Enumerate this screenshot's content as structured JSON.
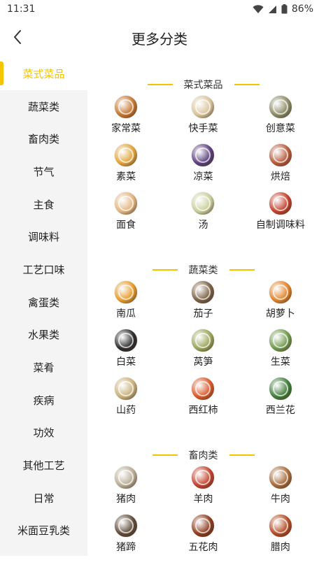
{
  "status": {
    "time": "11:31",
    "battery": "86%"
  },
  "header": {
    "title": "更多分类"
  },
  "sidebar": {
    "items": [
      {
        "label": "菜式菜品"
      },
      {
        "label": "蔬菜类"
      },
      {
        "label": "畜肉类"
      },
      {
        "label": "节气"
      },
      {
        "label": "主食"
      },
      {
        "label": "调味料"
      },
      {
        "label": "工艺口味"
      },
      {
        "label": "禽蛋类"
      },
      {
        "label": "水果类"
      },
      {
        "label": "菜肴"
      },
      {
        "label": "疾病"
      },
      {
        "label": "功效"
      },
      {
        "label": "其他工艺"
      },
      {
        "label": "日常"
      },
      {
        "label": "米面豆乳类"
      }
    ]
  },
  "sections": [
    {
      "title": "菜式菜品",
      "items": [
        {
          "label": "家常菜",
          "icon": "dish-photo",
          "color": "#c4752e"
        },
        {
          "label": "快手菜",
          "icon": "dish-photo",
          "color": "#d9c39a"
        },
        {
          "label": "创意菜",
          "icon": "dish-photo",
          "color": "#8a8a64"
        },
        {
          "label": "素菜",
          "icon": "dish-photo",
          "color": "#e0a33a"
        },
        {
          "label": "凉菜",
          "icon": "dish-photo",
          "color": "#5b3f7d"
        },
        {
          "label": "烘焙",
          "icon": "dish-photo",
          "color": "#b75a3b"
        },
        {
          "label": "面食",
          "icon": "dish-photo",
          "color": "#e2b47d"
        },
        {
          "label": "汤",
          "icon": "dish-photo",
          "color": "#c9cf9a"
        },
        {
          "label": "自制调味料",
          "icon": "dish-photo",
          "color": "#c2412d"
        }
      ]
    },
    {
      "title": "蔬菜类",
      "items": [
        {
          "label": "南瓜",
          "icon": "dish-photo",
          "color": "#e59a2c"
        },
        {
          "label": "茄子",
          "icon": "dish-photo",
          "color": "#7a6044"
        },
        {
          "label": "胡萝卜",
          "icon": "dish-photo",
          "color": "#e0832a"
        },
        {
          "label": "白菜",
          "icon": "dish-photo",
          "color": "#2b2b2b"
        },
        {
          "label": "莴笋",
          "icon": "dish-photo",
          "color": "#9aa55a"
        },
        {
          "label": "生菜",
          "icon": "dish-photo",
          "color": "#6f9a4d"
        },
        {
          "label": "山药",
          "icon": "dish-photo",
          "color": "#c8b07a"
        },
        {
          "label": "西红柿",
          "icon": "dish-photo",
          "color": "#d8582a"
        },
        {
          "label": "西兰花",
          "icon": "dish-photo",
          "color": "#3f7d3a"
        }
      ]
    },
    {
      "title": "畜肉类",
      "items": [
        {
          "label": "猪肉",
          "icon": "dish-photo",
          "color": "#b8ab95"
        },
        {
          "label": "羊肉",
          "icon": "dish-photo",
          "color": "#c2412d"
        },
        {
          "label": "牛肉",
          "icon": "dish-photo",
          "color": "#a66a3a"
        },
        {
          "label": "猪蹄",
          "icon": "dish-photo",
          "color": "#5e4a39"
        },
        {
          "label": "五花肉",
          "icon": "dish-photo",
          "color": "#8a3b1e"
        },
        {
          "label": "腊肉",
          "icon": "dish-photo",
          "color": "#b34a24"
        }
      ]
    }
  ]
}
